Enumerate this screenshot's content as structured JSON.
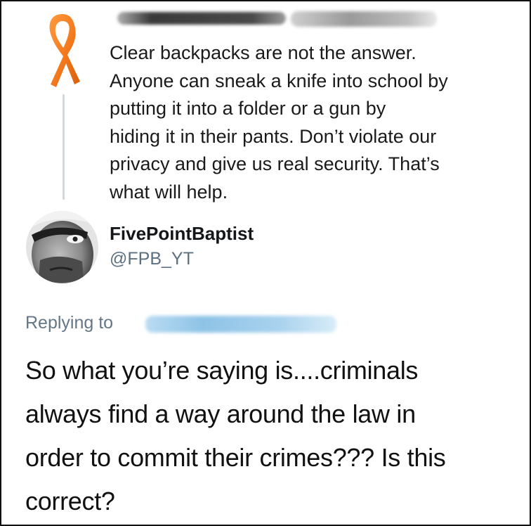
{
  "parent_tweet": {
    "text": "Clear backpacks are not the answer.\nAnyone can sneak a knife into school by\nputting it into a folder or a gun by\nhiding it in their pants. Don’t violate our\nprivacy and give us real security. That’s\nwhat will help.",
    "avatar_icon": "orange-awareness-ribbon-icon",
    "ribbon_color": "#f47b20"
  },
  "reply_tweet": {
    "display_name": "FivePointBaptist",
    "handle": "@FPB_YT",
    "replying_to_label": "Replying to",
    "text": "So what you’re saying is....criminals\nalways find a way around the law in\norder to commit their crimes??? Is this\ncorrect?",
    "avatar_icon": "user-avatar-photo-icon"
  },
  "colors": {
    "handle": "#5b7083",
    "link_redaction": "#9ecbe8"
  }
}
